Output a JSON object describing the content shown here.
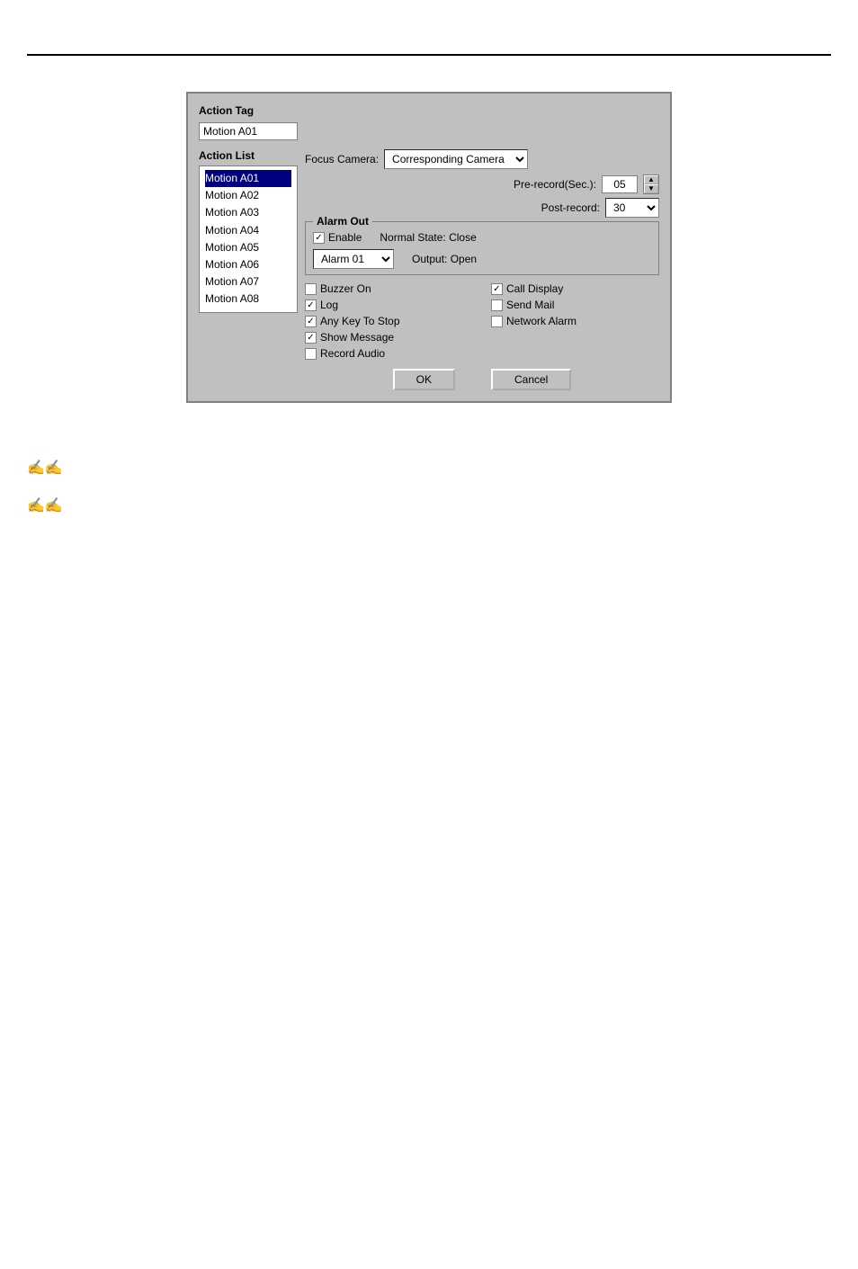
{
  "dialog": {
    "title": "Action Tag",
    "action_tag_value": "Motion A01",
    "action_list_label": "Action List",
    "action_list_items": [
      "Motion A01",
      "Motion A02",
      "Motion A03",
      "Motion A04",
      "Motion A05",
      "Motion A06",
      "Motion A07",
      "Motion A08"
    ],
    "focus_camera_label": "Focus Camera:",
    "focus_camera_value": "Corresponding Camera",
    "pre_record_label": "Pre-record(Sec.):",
    "pre_record_value": "05",
    "post_record_label": "Post-record:",
    "post_record_value": "30",
    "alarm_out_label": "Alarm Out",
    "enable_label": "Enable",
    "normal_state_label": "Normal State:  Close",
    "alarm_select_value": "Alarm 01",
    "output_label": "Output:  Open",
    "options": [
      {
        "label": "Buzzer On",
        "checked": false,
        "col": 1
      },
      {
        "label": "Call Display",
        "checked": true,
        "col": 2
      },
      {
        "label": "Log",
        "checked": true,
        "col": 1
      },
      {
        "label": "Send Mail",
        "checked": false,
        "col": 2
      },
      {
        "label": "Any Key To Stop",
        "checked": true,
        "col": 1
      },
      {
        "label": "Network Alarm",
        "checked": false,
        "col": 2
      },
      {
        "label": "Show Message",
        "checked": true,
        "col": 1
      },
      {
        "label": "Record Audio",
        "checked": false,
        "col": 1
      }
    ],
    "ok_label": "OK",
    "cancel_label": "Cancel"
  },
  "notes": [
    {
      "icon": "✍",
      "text": ""
    },
    {
      "icon": "✍",
      "text": ""
    }
  ]
}
